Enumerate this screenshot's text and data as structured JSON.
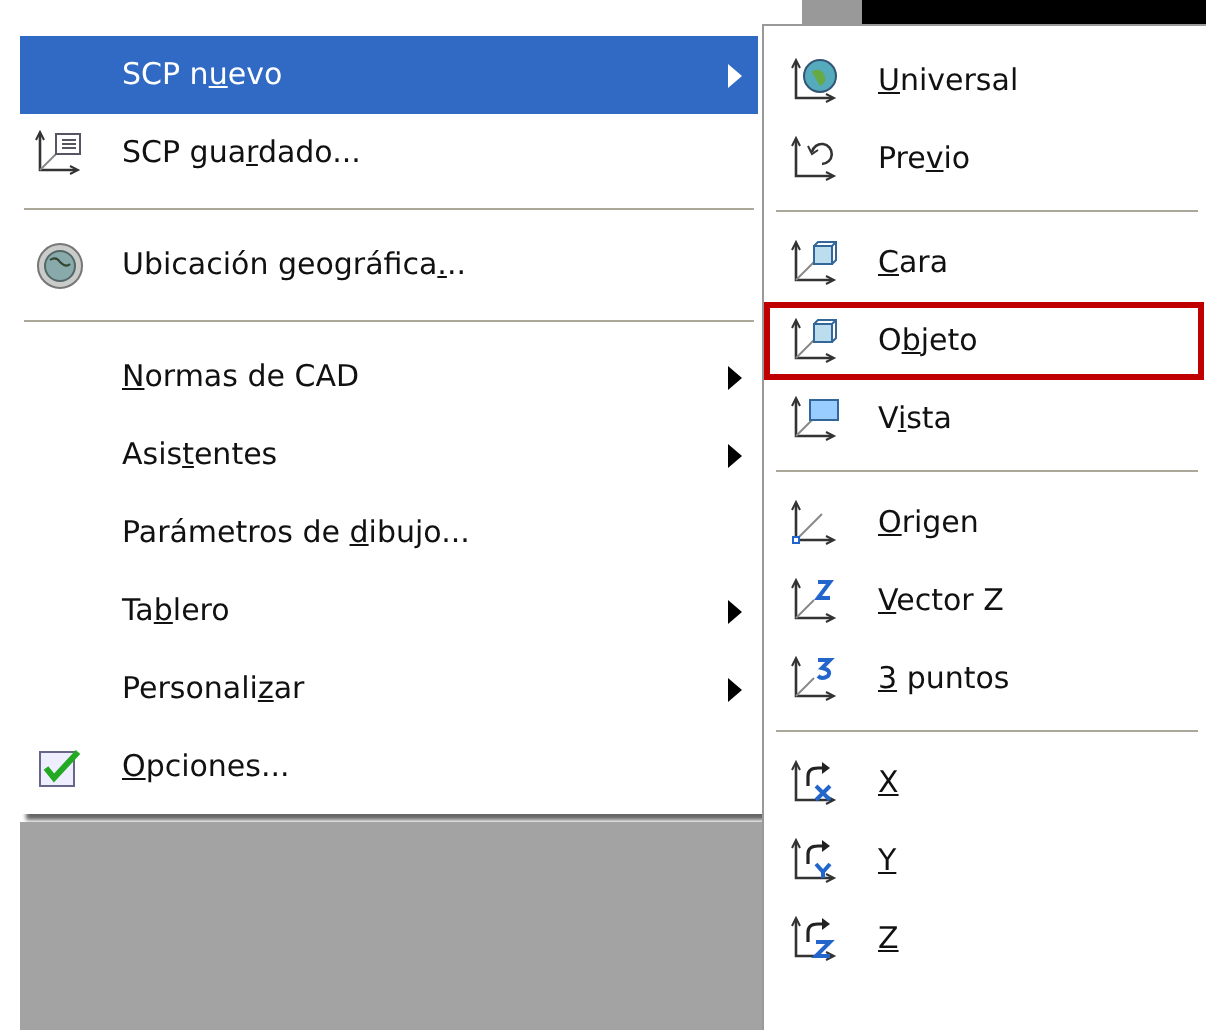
{
  "menu": {
    "groups": [
      [
        {
          "pre": "SCP n",
          "key": "u",
          "post": "evo",
          "kind": "none",
          "submenu": true,
          "selected": true
        },
        {
          "pre": "SCP gua",
          "key": "r",
          "post": "dado...",
          "kind": "ucs-list",
          "submenu": false,
          "selected": false
        }
      ],
      [
        {
          "pre": "Ubicación geográfica",
          "key": ".",
          "post": "..",
          "kind": "globe",
          "submenu": false,
          "selected": false
        }
      ],
      [
        {
          "key": "N",
          "post": "ormas de CAD",
          "kind": "none",
          "submenu": true,
          "selected": false
        },
        {
          "pre": "Asis",
          "key": "t",
          "post": "entes",
          "kind": "none",
          "submenu": true,
          "selected": false
        },
        {
          "pre": "Parámetros de ",
          "key": "d",
          "post": "ibujo...",
          "kind": "none",
          "submenu": false,
          "selected": false
        },
        {
          "pre": "Ta",
          "key": "b",
          "post": "lero",
          "kind": "none",
          "submenu": true,
          "selected": false
        },
        {
          "pre": "Personali",
          "key": "z",
          "post": "ar",
          "kind": "none",
          "submenu": true,
          "selected": false
        },
        {
          "key": "O",
          "post": "pciones...",
          "kind": "check",
          "submenu": false,
          "selected": false
        }
      ]
    ]
  },
  "submenu": {
    "groups": [
      [
        {
          "key": "U",
          "post": "niversal",
          "kind": "world",
          "outlined": false
        },
        {
          "pre": "Pre",
          "key": "v",
          "post": "io",
          "kind": "previous",
          "outlined": false
        }
      ],
      [
        {
          "key": "C",
          "post": "ara",
          "kind": "face",
          "outlined": false
        },
        {
          "pre": "O",
          "key": "b",
          "post": "jeto",
          "kind": "object",
          "outlined": true
        },
        {
          "pre": "V",
          "key": "i",
          "post": "sta",
          "kind": "view",
          "outlined": false
        }
      ],
      [
        {
          "key": "O",
          "post": "rigen",
          "kind": "origin",
          "outlined": false
        },
        {
          "key": "V",
          "post": "ector Z",
          "kind": "zvector",
          "outlined": false
        },
        {
          "key": "3",
          "post": " puntos",
          "kind": "three",
          "outlined": false
        }
      ],
      [
        {
          "key": "X",
          "kind": "rx",
          "outlined": false
        },
        {
          "key": "Y",
          "kind": "ry",
          "outlined": false
        },
        {
          "key": "Z",
          "kind": "rz",
          "outlined": false
        }
      ]
    ]
  }
}
